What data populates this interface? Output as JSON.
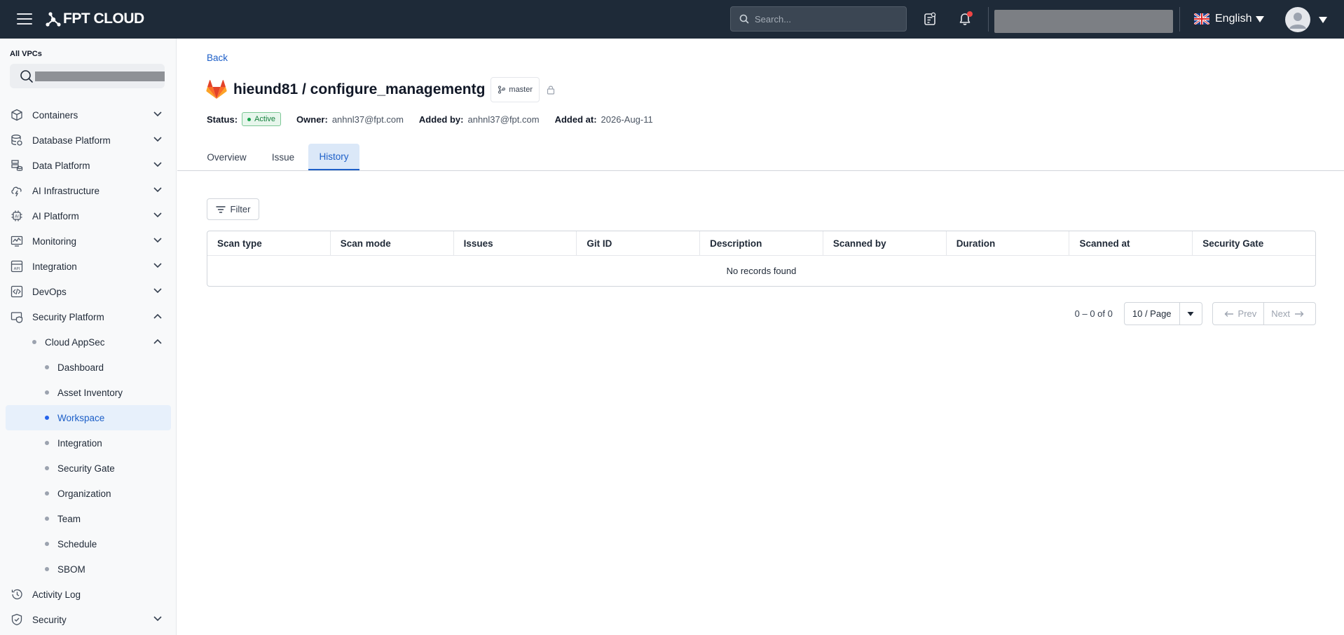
{
  "topbar": {
    "logo_text": "FPT CLOUD",
    "search_placeholder": "Search...",
    "language": "English"
  },
  "sidebar": {
    "vpc_label": "All VPCs",
    "items": [
      {
        "label": "Containers",
        "icon": "cube-icon",
        "expanded": false
      },
      {
        "label": "Database Platform",
        "icon": "database-icon",
        "expanded": false
      },
      {
        "label": "Data Platform",
        "icon": "data-platform-icon",
        "expanded": false
      },
      {
        "label": "AI Infrastructure",
        "icon": "ai-infrastructure-icon",
        "expanded": false
      },
      {
        "label": "AI Platform",
        "icon": "ai-chip-icon",
        "expanded": false
      },
      {
        "label": "Monitoring",
        "icon": "monitoring-icon",
        "expanded": false
      },
      {
        "label": "Integration",
        "icon": "api-icon",
        "expanded": false
      },
      {
        "label": "DevOps",
        "icon": "devops-icon",
        "expanded": false
      },
      {
        "label": "Security Platform",
        "icon": "security-platform-icon",
        "expanded": true
      }
    ],
    "cloud_appsec": "Cloud AppSec",
    "sub_items": [
      "Dashboard",
      "Asset Inventory",
      "Workspace",
      "Integration",
      "Security Gate",
      "Organization",
      "Team",
      "Schedule",
      "SBOM"
    ],
    "active_sub": "Workspace",
    "activity_log": "Activity Log",
    "security": "Security"
  },
  "page": {
    "back": "Back",
    "title": "hieund81 / configure_managementg",
    "branch": "master",
    "status_label": "Status:",
    "status": "Active",
    "owner_label": "Owner:",
    "owner": "anhnl37@fpt.com",
    "added_by_label": "Added by:",
    "added_by": "anhnl37@fpt.com",
    "added_at_label": "Added at:",
    "added_at": "2026-Aug-11",
    "tabs": [
      "Overview",
      "Issue",
      "History"
    ],
    "active_tab": "History",
    "filter": "Filter"
  },
  "table": {
    "columns": [
      "Scan type",
      "Scan mode",
      "Issues",
      "Git ID",
      "Description",
      "Scanned by",
      "Duration",
      "Scanned at",
      "Security Gate"
    ],
    "empty_text": "No records found"
  },
  "pagination": {
    "range": "0 – 0 of 0",
    "page_size": "10 / Page",
    "prev": "Prev",
    "next": "Next"
  },
  "colors": {
    "topbar": "#1e2a38",
    "accent": "#1d5fc8",
    "active_bg": "#e7f0fb",
    "status_green": "#15803d",
    "gitlab_orange": "#e24329"
  }
}
